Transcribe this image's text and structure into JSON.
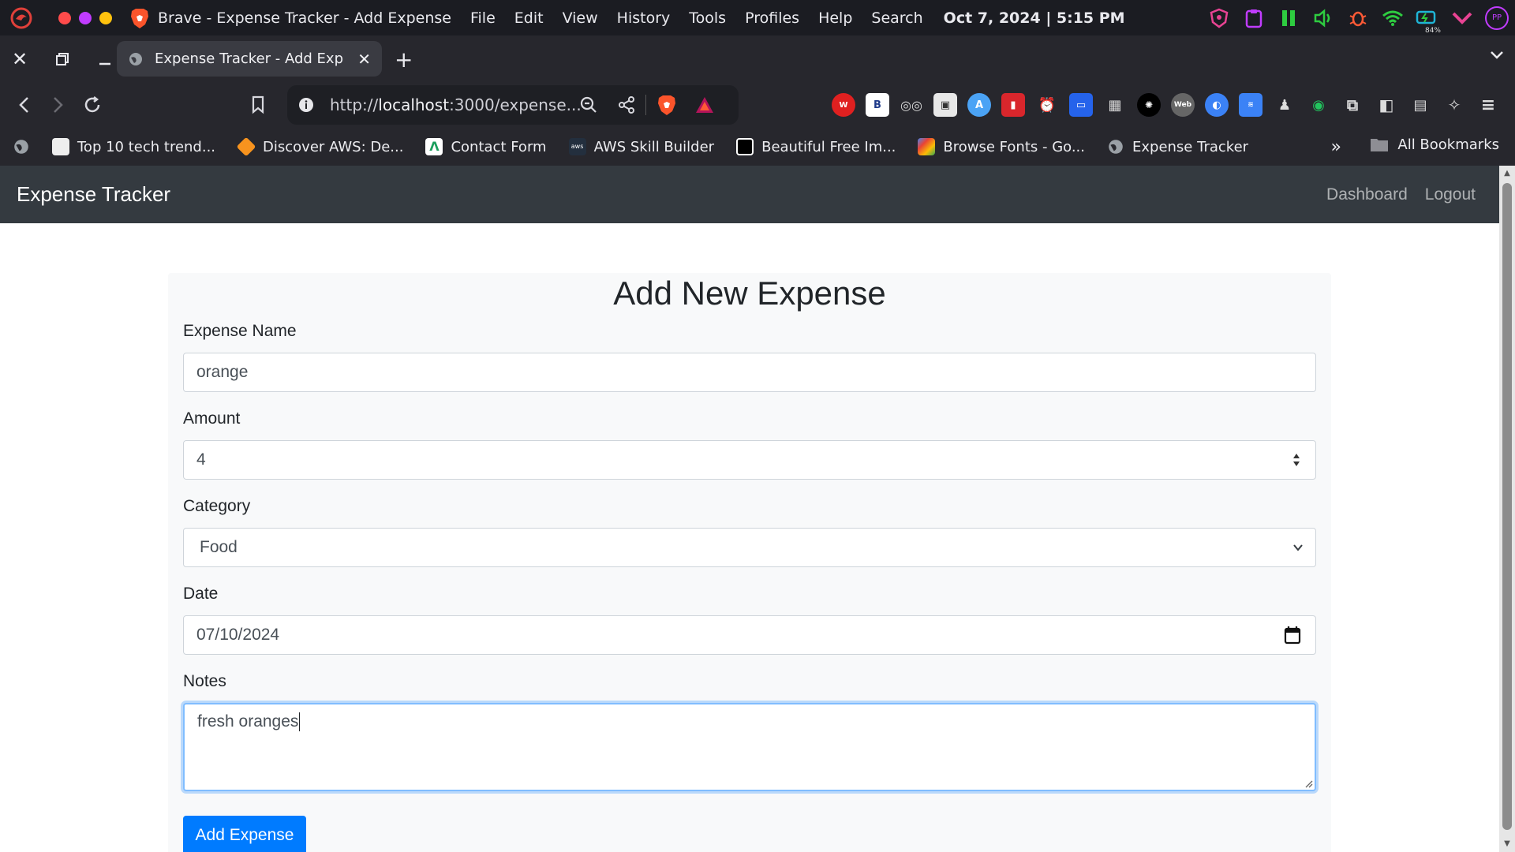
{
  "os": {
    "app_title": "Brave - Expense Tracker - Add Expense",
    "menu": [
      "File",
      "Edit",
      "View",
      "History",
      "Tools",
      "Profiles",
      "Help",
      "Search"
    ],
    "clock": "Oct 7, 2024 | 5:15 PM",
    "battery_percent": "84%",
    "profile_initials": "PP",
    "traffic_colors": [
      "#ff4b4b",
      "#c13cff",
      "#ffc20e"
    ]
  },
  "browser": {
    "tab_title": "Expense Tracker - Add Expense",
    "url_prefix": "http://",
    "url_host": "localhost",
    "url_rest": ":3000/expense...",
    "bookmarks": [
      {
        "label": "Top 10 tech trend...",
        "icon": "doc-icon",
        "color": "#eeeeee"
      },
      {
        "label": "Discover AWS: De...",
        "icon": "aws-cube-icon",
        "color": "#f7931e"
      },
      {
        "label": "Contact Form",
        "icon": "form-icon",
        "color": "#ffffff"
      },
      {
        "label": "AWS Skill Builder",
        "icon": "aws-icon",
        "color": "#232f3e"
      },
      {
        "label": "Beautiful Free Im...",
        "icon": "unsplash-icon",
        "color": "#000000"
      },
      {
        "label": "Browse Fonts - Go...",
        "icon": "google-fonts-icon",
        "color": "#4285f4"
      },
      {
        "label": "Expense Tracker",
        "icon": "globe-icon",
        "color": "#9aa0a6"
      }
    ],
    "all_bookmarks": "All Bookmarks"
  },
  "app": {
    "brand": "Expense Tracker",
    "nav": {
      "dashboard": "Dashboard",
      "logout": "Logout"
    },
    "form": {
      "title": "Add New Expense",
      "name_label": "Expense Name",
      "name_value": "orange",
      "amount_label": "Amount",
      "amount_value": "4",
      "category_label": "Category",
      "category_value": "Food",
      "date_label": "Date",
      "date_value": "07/10/2024",
      "notes_label": "Notes",
      "notes_value": "fresh oranges",
      "submit": "Add Expense"
    }
  },
  "colors": {
    "navbar_bg": "#343a40",
    "primary": "#007bff",
    "card_bg": "#f8f9fa"
  }
}
